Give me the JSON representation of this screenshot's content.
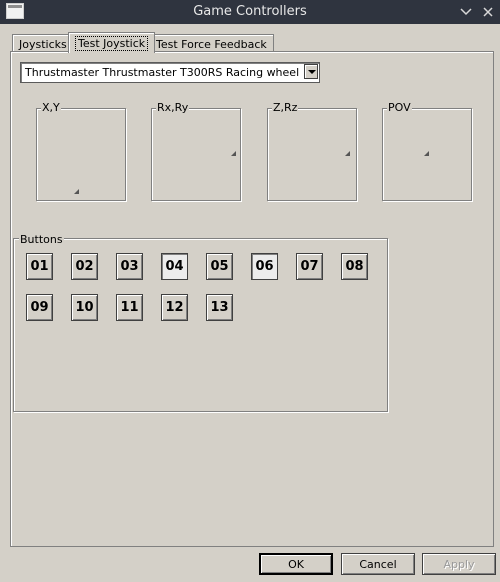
{
  "window": {
    "title": "Game Controllers"
  },
  "tabs": [
    {
      "label": "Joysticks"
    },
    {
      "label": "Test Joystick",
      "active": true
    },
    {
      "label": "Test Force Feedback"
    }
  ],
  "device": {
    "selected": "Thrustmaster Thrustmaster T300RS Racing wheel"
  },
  "axes": [
    {
      "label": "X,Y"
    },
    {
      "label": "Rx,Ry"
    },
    {
      "label": "Z,Rz"
    },
    {
      "label": "POV"
    }
  ],
  "buttons_group": {
    "label": "Buttons",
    "buttons": [
      {
        "label": "01",
        "pressed": false
      },
      {
        "label": "02",
        "pressed": false
      },
      {
        "label": "03",
        "pressed": false
      },
      {
        "label": "04",
        "pressed": true
      },
      {
        "label": "05",
        "pressed": false
      },
      {
        "label": "06",
        "pressed": true
      },
      {
        "label": "07",
        "pressed": false
      },
      {
        "label": "08",
        "pressed": false
      },
      {
        "label": "09",
        "pressed": false
      },
      {
        "label": "10",
        "pressed": false
      },
      {
        "label": "11",
        "pressed": false
      },
      {
        "label": "12",
        "pressed": false
      },
      {
        "label": "13",
        "pressed": false
      }
    ]
  },
  "footer": {
    "ok_label": "OK",
    "cancel_label": "Cancel",
    "apply_label": "Apply"
  }
}
